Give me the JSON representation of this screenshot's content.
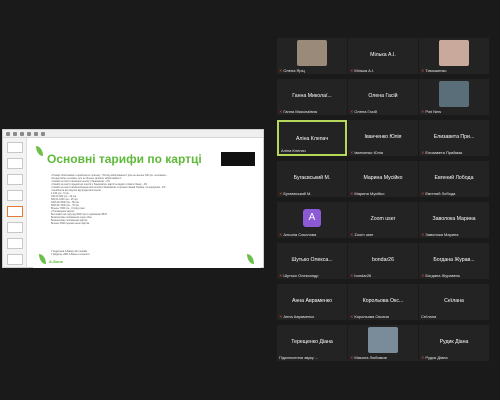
{
  "slide": {
    "title": "Основні тарифи по картці",
    "body": [
      "• Розмір обов'язкового щомісячного платежу - 5% від заборгованості (але не менше 100 грн. за кожним ...",
      "  погодне місце за кожен, але не більше залишку заборгованості",
      "• Комісія за зняття власних коштів у банкоматах - 0%",
      "• Комісія за зняття кредитних коштів у банкоматах, вартість видачі готівки в банку - 4%",
      "• Комісія за зняття власних/кредитних коштів в банкоматах сторонніх банків України і за кордоном - 2%",
      "• Кешбек на всі покупки від кредитних коштів",
      "    1-100 грн - 5 грн",
      "    100,01-500 грн - 10 грн",
      "    500,01-1000 грн - 25 грн",
      "    1000,01-5000 грн - 50 грн",
      "    5000,01-7000 грн - 75 грн",
      "    Більше 7000 грн - 1% від суми",
      "• Поповнення картки:",
      "    Без комісії на суму від 3000 грн в терміналах iBOX",
      "    Безкоштовне поповнення через Visa",
      "    Безкоштовне поповнення картки",
      "    Більше 3000 переказ на всі картки"
    ],
    "footer": [
      "У відділенні А-Банку або онлайн",
      "У Додатку «Мій А-Банк» в каталозі"
    ],
    "logo": "А-Банк"
  },
  "gallery": [
    {
      "center": "",
      "label": "Олена Яріц",
      "muted": true,
      "video": true,
      "video_color": "#9a8a7a"
    },
    {
      "center": "Мілька А.І.",
      "label": "Мілька А.І.",
      "muted": true,
      "video": false
    },
    {
      "center": "",
      "label": "Тимошенко",
      "muted": true,
      "video": true,
      "video_color": "#c9a99b"
    },
    {
      "center": "Ганна Миколаї...",
      "label": "Ганна Миколаївна",
      "muted": true,
      "video": false
    },
    {
      "center": "Олена Гасій",
      "label": "Олена Гасій",
      "muted": true,
      "video": false
    },
    {
      "center": "",
      "label": "Pwt New",
      "muted": true,
      "video": true,
      "video_color": "#5a6e7a"
    },
    {
      "center": "Аліна Клепач",
      "label": "Аліна Клепач",
      "muted": false,
      "video": false,
      "speaking": true
    },
    {
      "center": "Іванченко Юлія",
      "label": "Іванченко Юлія",
      "muted": true,
      "video": false
    },
    {
      "center": "Елизавета При...",
      "label": "Елизавета Приймак",
      "muted": true,
      "video": false
    },
    {
      "center": "Бугаєвський М.",
      "label": "Бугаєвський М.",
      "muted": true,
      "video": false
    },
    {
      "center": "Марина Мусійко",
      "label": "Марина Мусійко",
      "muted": true,
      "video": false
    },
    {
      "center": "Евгений Лобода",
      "label": "Евгений Лобода",
      "muted": true,
      "video": false
    },
    {
      "center": "",
      "label": "Альона Соколова",
      "muted": true,
      "video": false,
      "avatar": "A"
    },
    {
      "center": "Zoom user",
      "label": "Zoom user",
      "muted": true,
      "video": false
    },
    {
      "center": "Заволока Марина",
      "label": "Заволока Марина",
      "muted": true,
      "video": false
    },
    {
      "center": "Шутько Олекса...",
      "label": "Шутько Олександр",
      "muted": true,
      "video": false
    },
    {
      "center": "bondar26",
      "label": "bondar26",
      "muted": true,
      "video": false
    },
    {
      "center": "Богдана Журав...",
      "label": "Богдана Журавель",
      "muted": true,
      "video": false
    },
    {
      "center": "Анна Авраменко",
      "label": "Анна Авраменко",
      "muted": true,
      "video": false
    },
    {
      "center": "Корольова Окс...",
      "label": "Корольова Оксана",
      "muted": true,
      "video": false
    },
    {
      "center": "Сеїлана",
      "label": "Сеїлана",
      "muted": false,
      "video": false
    },
    {
      "center": "Терещенко Діана",
      "label": "Підключення звуку ...",
      "muted": false,
      "video": false
    },
    {
      "center": "",
      "label": "Микола Любимов",
      "muted": true,
      "video": true,
      "video_color": "#7a8b9a"
    },
    {
      "center": "Рудик Діана",
      "label": "Рудик Діана",
      "muted": true,
      "video": false
    }
  ]
}
